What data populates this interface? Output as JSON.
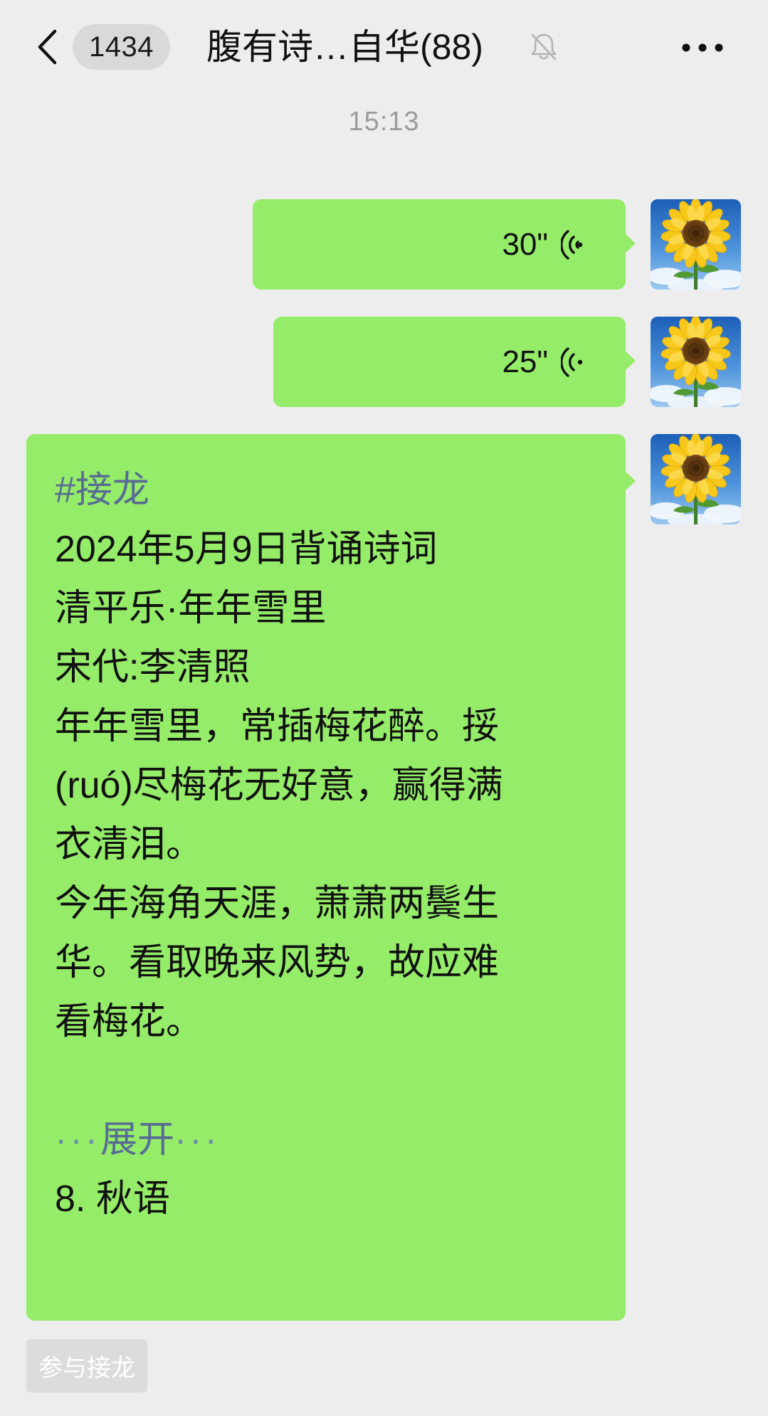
{
  "header": {
    "unread_count": "1434",
    "title": "腹有诗…自华(88)",
    "icons": {
      "back": "chevron-left-icon",
      "mute": "bell-off-icon",
      "more": "more-horizontal-icon"
    }
  },
  "timestamp": "15:13",
  "messages": [
    {
      "type": "voice",
      "duration": "30\"",
      "icon": "voice-wave-icon"
    },
    {
      "type": "voice",
      "duration": "25\"",
      "icon": "voice-wave-icon"
    },
    {
      "type": "text",
      "lines": [
        "#接龙",
        "2024年5月9日背诵诗词",
        "清平乐·年年雪里",
        "宋代:李清照",
        "年年雪里，常插梅花醉。挼",
        "(ruó)尽梅花无好意，赢得满",
        "衣清泪。",
        "今年海角天涯，萧萧两鬓生",
        "华。看取晚来风势，故应难",
        "看梅花。",
        "",
        "",
        "8. 秋语"
      ],
      "expand": {
        "dots_before": "···",
        "label": "展开",
        "dots_after": "···"
      }
    }
  ],
  "join_button": {
    "label": "参与接龙"
  },
  "colors": {
    "background": "#ededed",
    "bubble_green": "#95ec69",
    "link_blue": "#576b95",
    "timestamp_gray": "#9b9b9b",
    "pill_gray": "#d9d9d9",
    "join_button_bg": "#dcdcdc"
  },
  "avatar": {
    "icon": "sunflower-avatar-icon"
  }
}
